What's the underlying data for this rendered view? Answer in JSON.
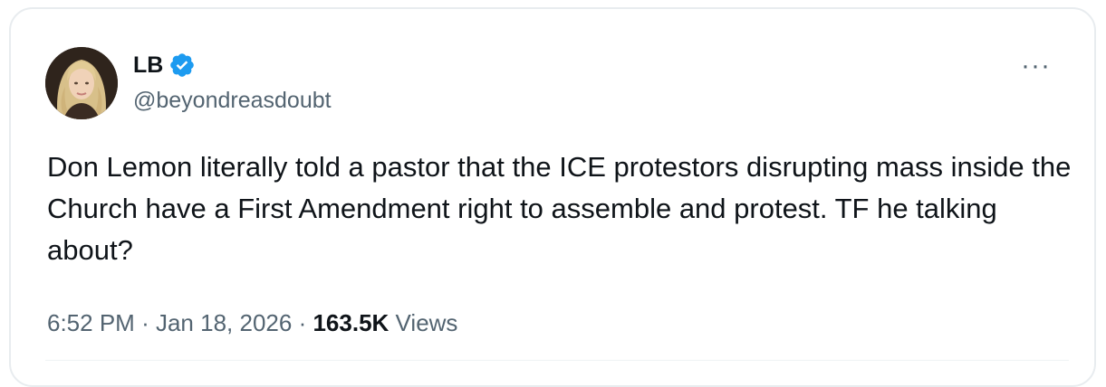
{
  "author": {
    "display_name": "LB",
    "handle": "@beyondreasdoubt",
    "verified": true,
    "verified_color": "#1d9bf0",
    "avatar_icon": "profile-photo"
  },
  "menu": {
    "more_label": "···"
  },
  "tweet": {
    "text": "Don Lemon literally told a pastor that the ICE protestors disrupting mass inside the Church have a First Amendment right to assemble and protest. TF he talking about?"
  },
  "meta": {
    "time": "6:52 PM",
    "separator": "·",
    "date": "Jan 18, 2026",
    "views_count": "163.5K",
    "views_label": "Views"
  },
  "colors": {
    "text_primary": "#0f1419",
    "text_secondary": "#536471",
    "border": "#e8ecef"
  }
}
